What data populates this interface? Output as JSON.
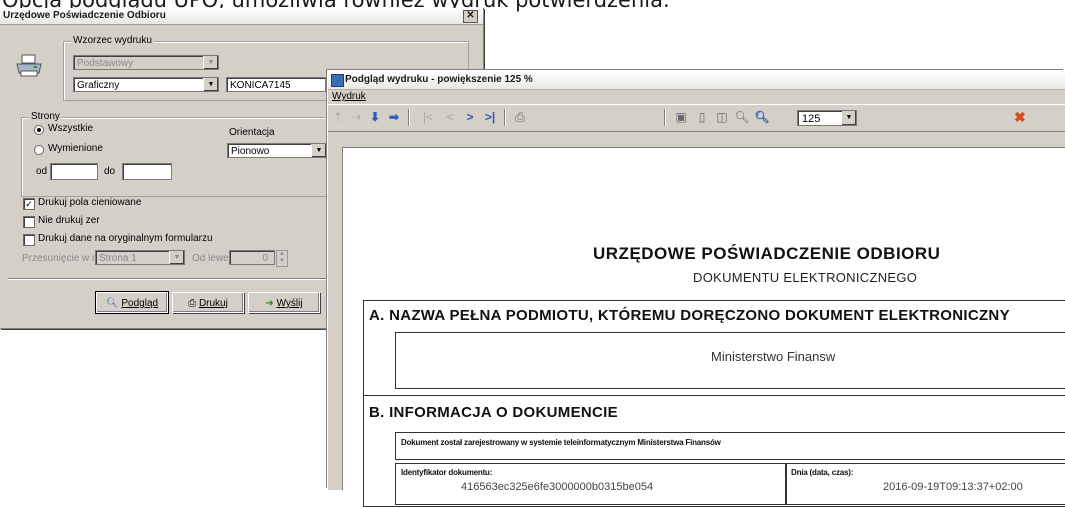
{
  "caption": "Opcja podglądu UPO, umożliwia również wydruk potwierdzenia.",
  "dialog": {
    "title": "Urzędowe Poświadczenie Odbioru",
    "template_group_label": "Wzorzec wydruku",
    "template_select": "Podstawowy",
    "mode_select": "Graficzny",
    "printer_field": "KONICA7145",
    "pages_group_label": "Strony",
    "radio_all": "Wszystkie",
    "radio_selected": "Wymienione",
    "orientation_label": "Orientacja",
    "orientation_value": "Pionowo",
    "from_label": "od",
    "to_label": "do",
    "print_shaded": "Drukuj pola cieniowane",
    "no_zeros": "Nie drukuj zer",
    "print_original": "Drukuj dane na oryginalnym formularzu",
    "offset_label": "Przesunięcie w mm",
    "offset_page": "Strona 1",
    "offset_left_label": "Od lewej",
    "offset_value": "0",
    "btn_preview": "Podgląd",
    "btn_print": "Drukuj",
    "btn_send": "Wyślij"
  },
  "preview": {
    "title": "Podgląd wydruku - powiększenie 125 %",
    "menu_print": "Wydruk",
    "zoom_value": "125",
    "doc_title": "URZĘDOWE POŚWIADCZENIE ODBIORU",
    "doc_subtitle": "DOKUMENTU ELEKTRONICZNEGO",
    "section_a": "A. NAZWA PEŁNA PODMIOTU, KTÓREMU DORĘCZONO DOKUMENT ELEKTRONICZNY",
    "ministry": "Ministerstwo Finansw",
    "section_b": "B. INFORMACJA O DOKUMENCIE",
    "registered_text": "Dokument został zarejestrowany w systemie teleinformatycznym Ministerstwa Finansów",
    "doc_id_label": "Identyfikator dokumentu:",
    "date_label": "Dnia (data, czas):",
    "doc_id_value": "416563ec325e6fe3000000b0315be054",
    "date_value": "2016-09-19T09:13:37+02:00"
  }
}
